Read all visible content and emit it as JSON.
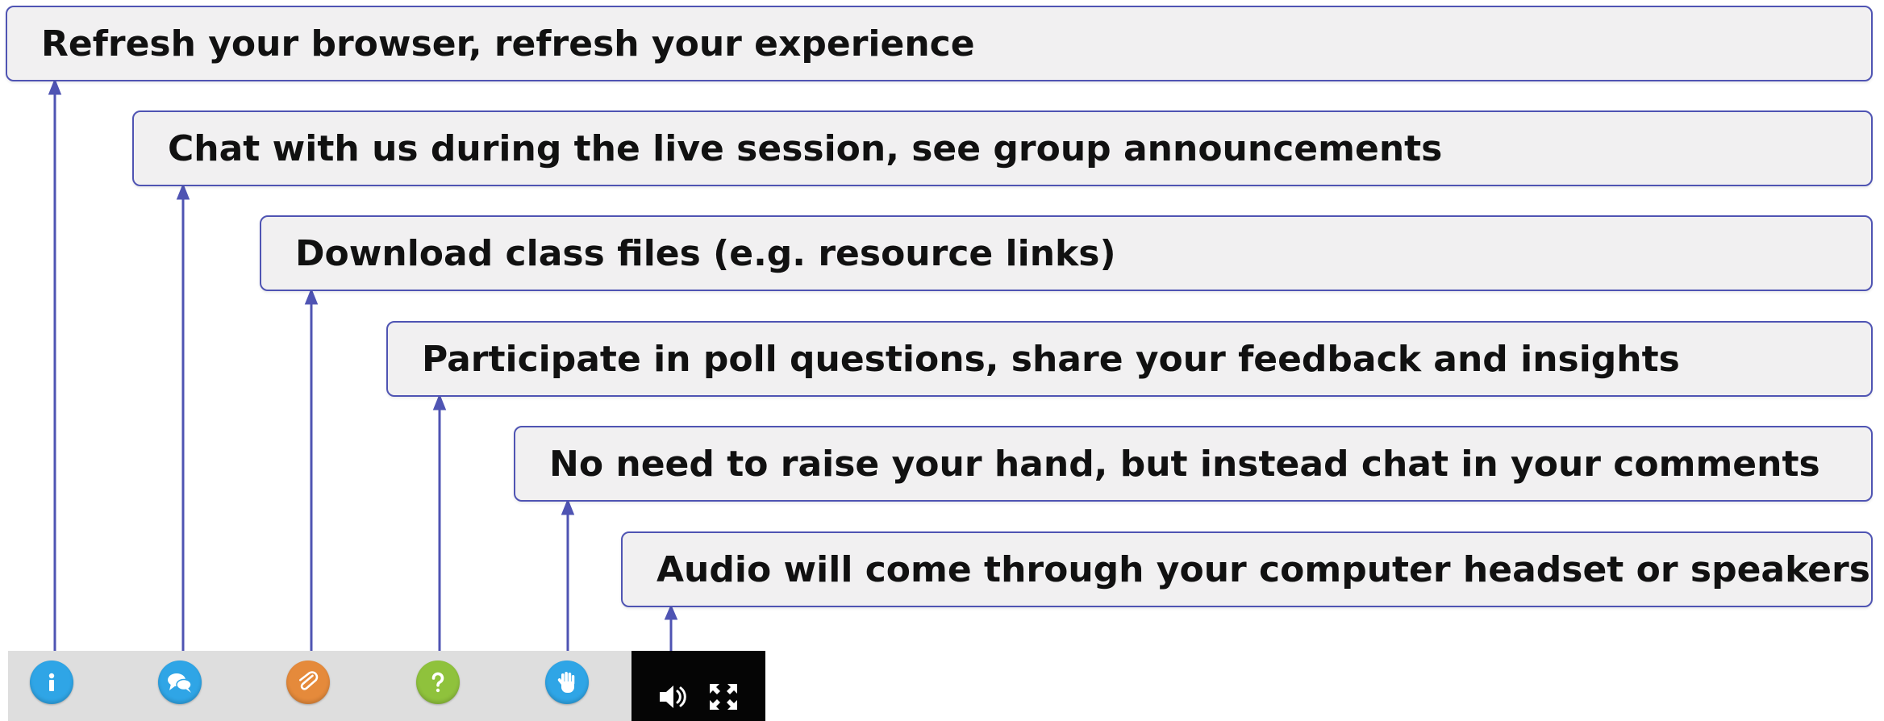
{
  "callouts": [
    {
      "id": "refresh",
      "text": "Refresh your browser, refresh your experience"
    },
    {
      "id": "chat",
      "text": "Chat with us during the live session, see group announcements"
    },
    {
      "id": "files",
      "text": "Download class files (e.g. resource links)"
    },
    {
      "id": "poll",
      "text": "Participate in poll questions, share your feedback and insights"
    },
    {
      "id": "hand",
      "text": "No need to raise your hand, but instead chat in your comments"
    },
    {
      "id": "audio",
      "text": "Audio will come through your computer headset or speakers"
    }
  ],
  "toolbar": {
    "buttons": [
      {
        "name": "info",
        "icon": "info-icon",
        "color": "#2fa5e6"
      },
      {
        "name": "chat",
        "icon": "chat-bubbles-icon",
        "color": "#2fa5e6"
      },
      {
        "name": "files",
        "icon": "paperclip-icon",
        "color": "#e58a3b"
      },
      {
        "name": "poll",
        "icon": "question-mark-icon",
        "color": "#8fc23c"
      },
      {
        "name": "raise-hand",
        "icon": "hand-icon",
        "color": "#2fa5e6"
      },
      {
        "name": "audio",
        "icon": "speaker-icon",
        "color": "#ffffff"
      },
      {
        "name": "fullscreen",
        "icon": "fullscreen-icon",
        "color": "#ffffff"
      }
    ]
  },
  "colors": {
    "connector": "#4f54b3",
    "callout_background": "#f1f0f1",
    "callout_border": "#4f54b3",
    "toolbar_light": "#dedede",
    "toolbar_dark": "#050505"
  }
}
